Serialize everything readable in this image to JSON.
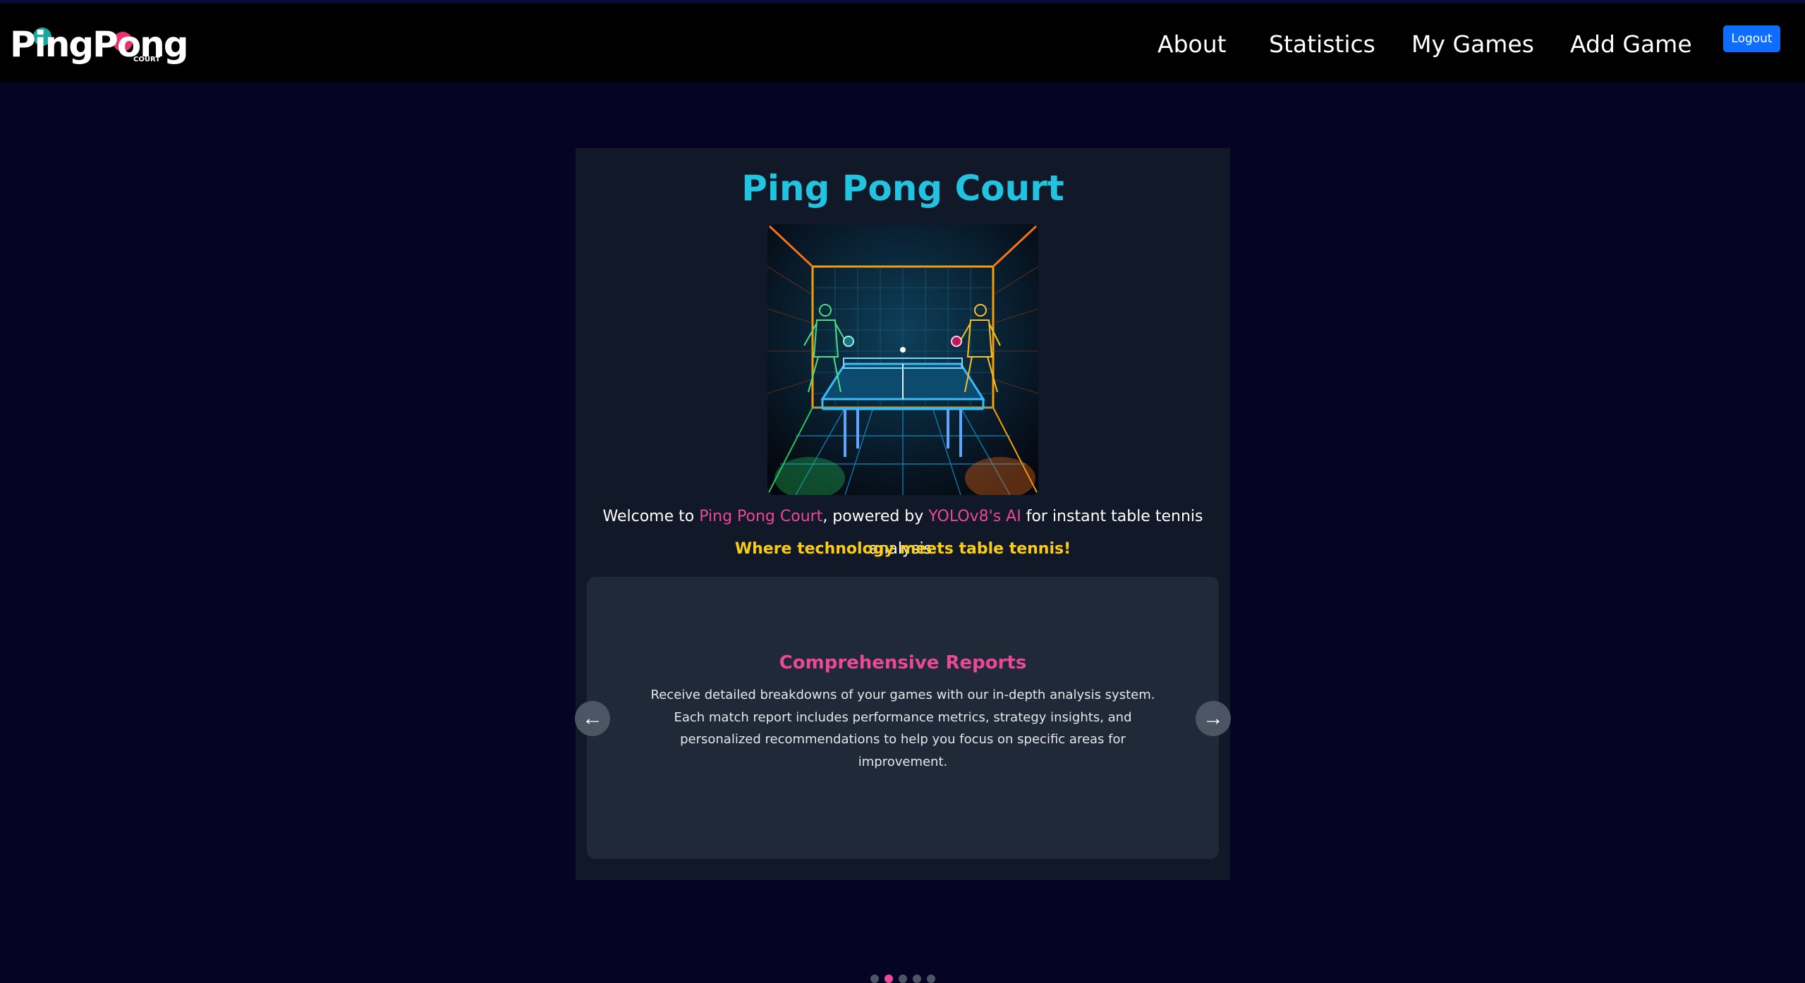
{
  "nav": {
    "logo_text": "PingPong",
    "logo_sub": "COURT",
    "links": [
      "About",
      "Statistics",
      "My Games",
      "Add Game"
    ],
    "logout_label": "Logout"
  },
  "main": {
    "title": "Ping Pong Court",
    "welcome": {
      "prefix": "Welcome to ",
      "highlight1": "Ping Pong Court",
      "middle": ", powered by ",
      "highlight2": "YOLOv8's AI",
      "suffix": " for instant table tennis analysis."
    },
    "tagline": "Where technology meets table tennis!",
    "carousel": {
      "slide_title": "Comprehensive Reports",
      "slide_text": "Receive detailed breakdowns of your games with our in-depth analysis system. Each match report includes performance metrics, strategy insights, and personalized recommendations to help you focus on specific areas for improvement.",
      "prev_icon": "←",
      "next_icon": "→",
      "dot_count": 5,
      "active_index": 1
    }
  },
  "colors": {
    "accent_pink": "#ec4899",
    "title_cyan": "#22c3e0",
    "tagline_yellow": "#facc15",
    "logout_blue": "#0d6efd"
  }
}
